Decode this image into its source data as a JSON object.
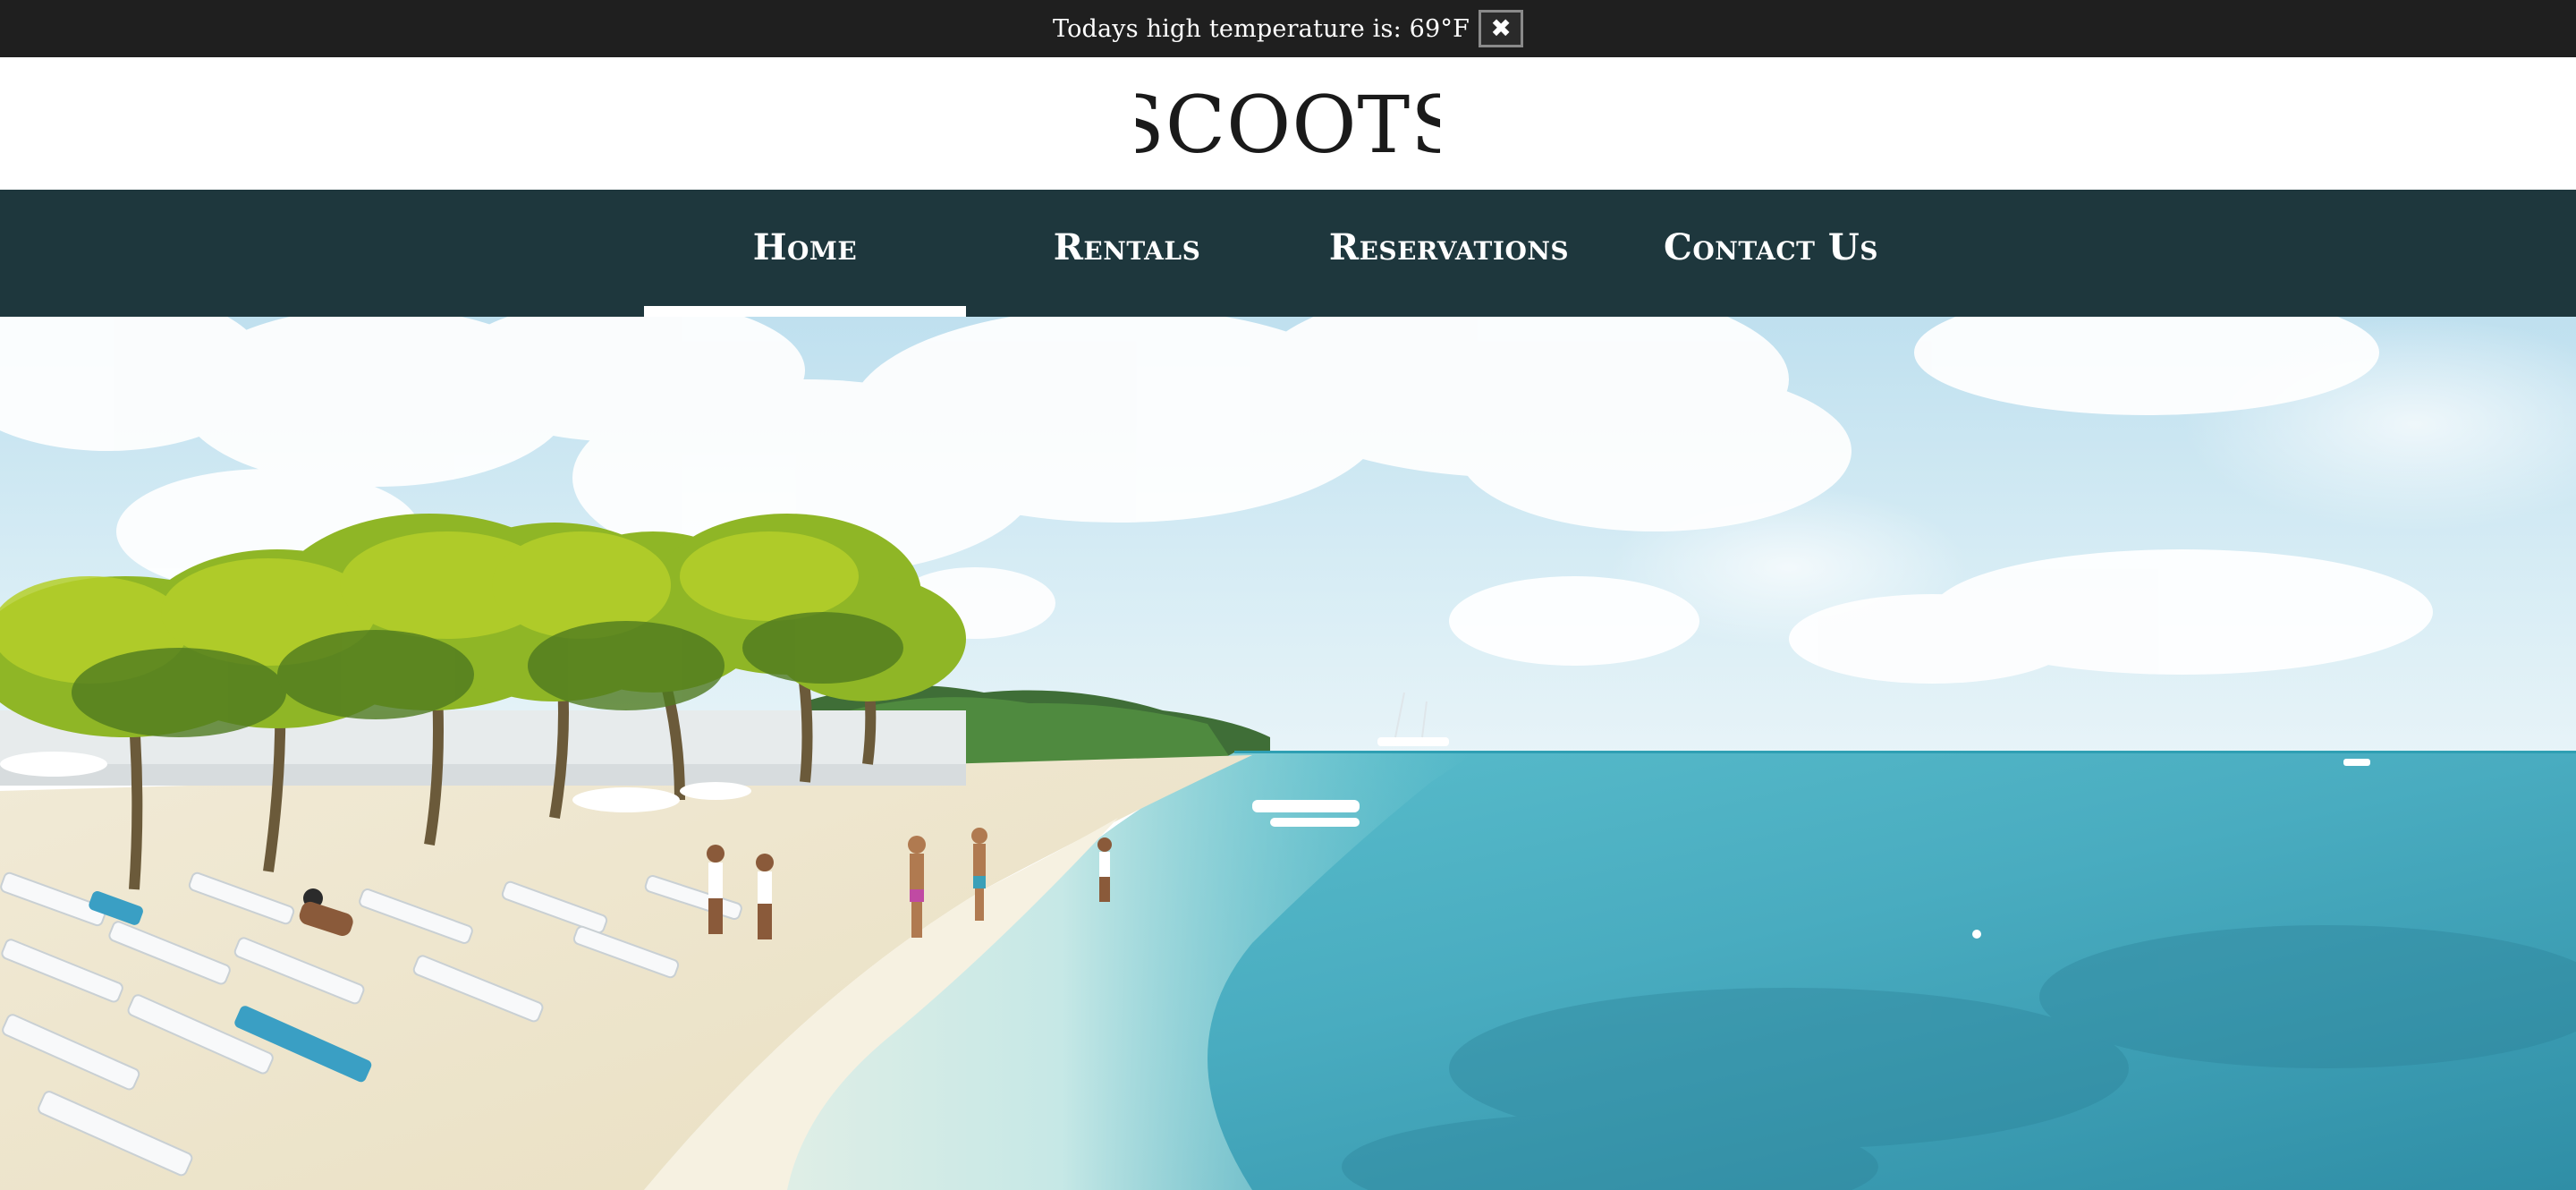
{
  "notice": {
    "message": "Todays high temperature is: 69°F",
    "close_glyph": "✖"
  },
  "brand": {
    "logo_text": "SCOOTS"
  },
  "nav": {
    "items": [
      {
        "label": "Home",
        "active": true
      },
      {
        "label": "Rentals",
        "active": false
      },
      {
        "label": "Reservations",
        "active": false
      },
      {
        "label": "Contact Us",
        "active": false
      }
    ]
  },
  "colors": {
    "topbar": "#1f1f1f",
    "nav": "#1e373d",
    "active_underline": "#ffffff"
  }
}
